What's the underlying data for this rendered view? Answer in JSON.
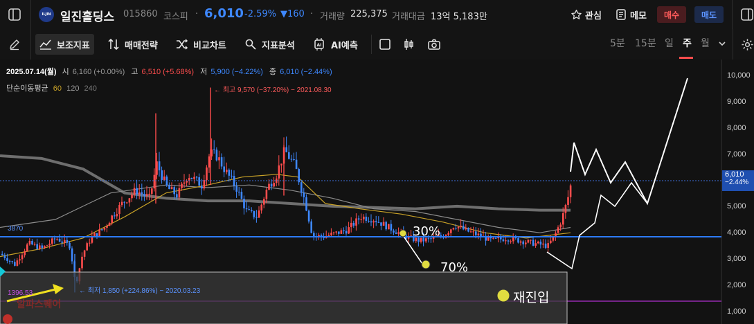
{
  "header": {
    "stock_name": "일진홀딩스",
    "stock_code": "015860",
    "market": "코스피",
    "price": "6,010",
    "change_pct": "-2.59%",
    "change_amt": "▼160",
    "volume_label": "거래량",
    "volume": "225,375",
    "turnover_label": "거래대금",
    "turnover": "13억 5,183만",
    "watch_label": "관심",
    "memo_label": "메모",
    "buy_label": "매수",
    "sell_label": "매도",
    "logo_text": "ILJIN"
  },
  "toolbar": {
    "indicators_label": "보조지표",
    "strategy_label": "매매전략",
    "compare_label": "비교차트",
    "analysis_label": "지표분석",
    "ai_label": "AI예측",
    "periods": [
      "5분",
      "15분",
      "일",
      "주",
      "월"
    ],
    "active_period": "주"
  },
  "info": {
    "date": "2025.07.14(월)",
    "open_label": "시",
    "open": "6,160 (+0.00%)",
    "high_label": "고",
    "high": "6,510 (+5.68%)",
    "low_label": "저",
    "low": "5,900 (−4.22%)",
    "close_label": "종",
    "close": "6,010 (−2.44%)",
    "ma_label": "단순이동평균",
    "ma1": "60",
    "ma2": "120",
    "ma3": "240"
  },
  "annotations": {
    "high_note": "← 최고 9,570 (−37.20%) − 2021.08.30",
    "low_note": "← 최저 1,850 (+224.86%) − 2020.03.23",
    "level_3870": "3870",
    "level_1396": "1396.53",
    "pct_30": "30%",
    "pct_70": "70%",
    "reentry": "재진입",
    "price_tag": "6,010",
    "price_tag_pct": "−2.44%",
    "watermark": "알파스퀘어"
  },
  "colors": {
    "up": "#ff4d4d",
    "down": "#3e88ff",
    "ma60": "#c9a227",
    "ma120": "#8c8c8c",
    "ma240": "#6e6e6e",
    "support": "#2d7bff",
    "bottom_line": "#b030d0",
    "dotted": "#3e6fd8"
  },
  "chart_data": {
    "type": "candlestick",
    "y_axis_ticks": [
      "10,000",
      "9,000",
      "8,000",
      "7,000",
      "6,000",
      "5,000",
      "4,000",
      "3,000",
      "2,000",
      "1,000"
    ],
    "current_price": 6010,
    "support_level": 3870,
    "bottom_level": 1396.53,
    "all_time_high": 9570,
    "all_time_low": 1850,
    "ylim": [
      1000,
      10000
    ]
  }
}
